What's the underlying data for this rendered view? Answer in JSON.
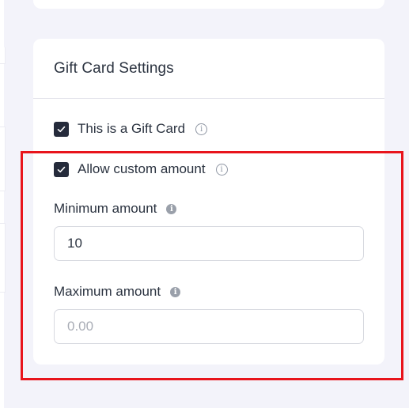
{
  "section": {
    "title": "Gift Card Settings"
  },
  "gift_card_checkbox": {
    "label": "This is a Gift Card",
    "checked": true,
    "info_icon": "info-circle-outline-icon"
  },
  "custom_amount_checkbox": {
    "label": "Allow custom amount",
    "checked": true,
    "info_icon": "info-circle-outline-icon"
  },
  "minimum_amount": {
    "label": "Minimum amount",
    "value": "10",
    "placeholder": "",
    "info_icon": "info-circle-filled-icon"
  },
  "maximum_amount": {
    "label": "Maximum amount",
    "value": "",
    "placeholder": "0.00",
    "info_icon": "info-circle-filled-icon"
  },
  "colors": {
    "highlight": "#e8141c",
    "checkbox": "#252b3b",
    "background": "#f3f3fa"
  }
}
